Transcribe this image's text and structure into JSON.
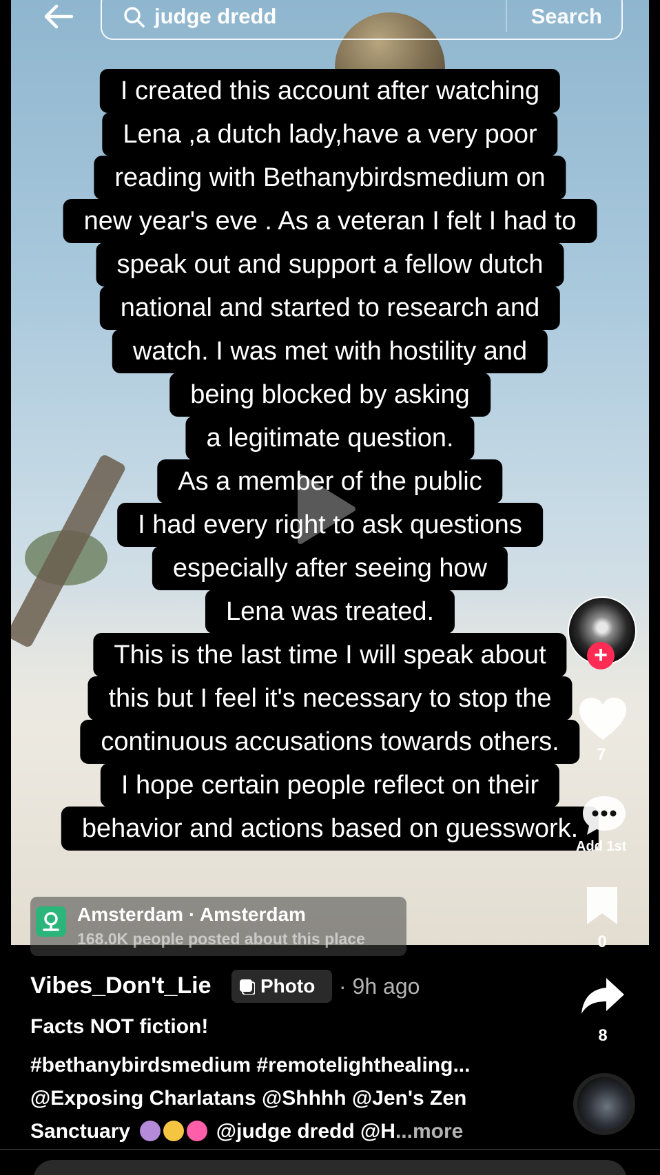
{
  "search": {
    "query": "judge dredd",
    "button_label": "Search"
  },
  "caption": {
    "lines": [
      "I created this account after watching",
      "Lena ,a dutch lady,have a very poor",
      "reading with Bethanybirdsmedium on",
      "new year's eve . As a veteran I felt I had to",
      "speak out and support a fellow dutch",
      "national and started to research and",
      "watch. I was met with hostility and",
      "being blocked by asking",
      "a legitimate question.",
      "As a member of the public",
      "I had every right to ask questions",
      "especially after seeing how",
      "Lena was treated.",
      "This is the last time I will speak about",
      "this but I feel it's necessary to stop the",
      "continuous accusations towards others.",
      "I hope certain people reflect on their",
      "behavior and actions based on guesswork."
    ]
  },
  "rail": {
    "like_count": "7",
    "comment_label": "Add 1st",
    "bookmark_count": "0",
    "share_count": "8"
  },
  "location": {
    "title": "Amsterdam · Amsterdam",
    "subtitle": "168.0K people posted about this place"
  },
  "post": {
    "username": "Vibes_Don't_Lie",
    "type_label": "Photo",
    "time": "· 9h ago",
    "title": "Facts NOT fiction!",
    "hashtags": "#bethanybirdsmedium #remotelighthealing...",
    "mentions_line1": "@Exposing Charlatans @Shhhh @Jen's Zen",
    "mentions_line2_prefix": "Sanctuary",
    "mentions_line2_suffix": "@judge dredd @H",
    "more_label": "...more"
  },
  "colors": {
    "accent_red": "#fe2c55",
    "pin_green": "#2bb57a"
  }
}
